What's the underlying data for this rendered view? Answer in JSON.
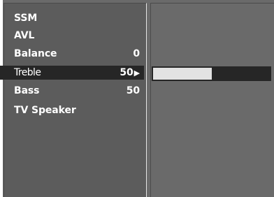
{
  "menu": {
    "items": [
      {
        "label": "SSM",
        "value": ""
      },
      {
        "label": "AVL",
        "value": ""
      },
      {
        "label": "Balance",
        "value": "0"
      },
      {
        "label": "Treble",
        "value": "50",
        "selected": true
      },
      {
        "label": "Bass",
        "value": "50"
      },
      {
        "label": "TV Speaker",
        "value": ""
      }
    ],
    "selected_arrow": "▶"
  },
  "slider": {
    "label": "Treble",
    "value": 50,
    "max": 100,
    "fill_color": "#e2e2e2",
    "track_color": "#262626"
  },
  "colors": {
    "panel_bg": "#5c5c5c",
    "selected_bg": "#262626",
    "text": "#ffffff"
  }
}
